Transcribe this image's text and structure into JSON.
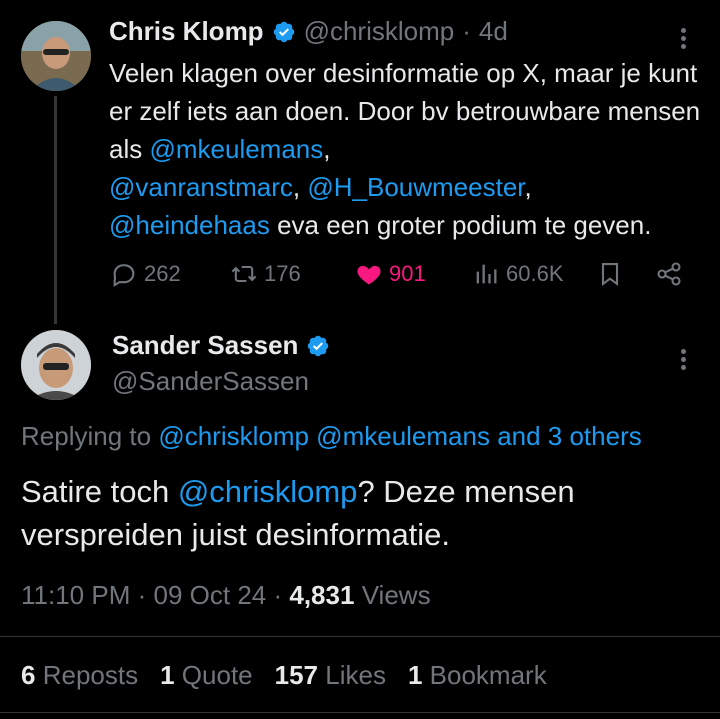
{
  "tweet1": {
    "name": "Chris Klomp",
    "handle": "@chrisklomp",
    "separator": "·",
    "age": "4d",
    "text_a": "Velen klagen over desinformatie op X, maar je kunt er zelf iets aan doen. Door bv betrouwbare mensen als ",
    "mention1": "@mkeulemans",
    "text_b": ",",
    "mention2": "@vanranstmarc",
    "text_c": ", ",
    "mention3": "@H_Bouwmeester",
    "text_d": ",",
    "mention4": "@heindehaas",
    "text_e": " eva een groter podium te geven.",
    "replies": "262",
    "reposts": "176",
    "likes": "901",
    "views": "60.6K"
  },
  "tweet2": {
    "name": "Sander Sassen",
    "handle": "@SanderSassen",
    "replying_prefix": "Replying to ",
    "replying_targets": "@chrisklomp @mkeulemans and 3 others",
    "text_a": "Satire toch ",
    "mention": "@chrisklomp",
    "text_b": "? Deze mensen verspreiden juist desinformatie.",
    "time": "11:10 PM",
    "date": "09 Oct 24",
    "views_count": "4,831",
    "views_label": "Views",
    "reposts_count": "6",
    "reposts_label": "Reposts",
    "quote_count": "1",
    "quote_label": "Quote",
    "likes_count": "157",
    "likes_label": "Likes",
    "bookmark_count": "1",
    "bookmark_label": "Bookmark"
  },
  "colors": {
    "background": "#000000",
    "text": "#e7e9ea",
    "muted": "#71767b",
    "link": "#1d9bf0",
    "like": "#f91880",
    "verified": "#1d9bf0"
  }
}
